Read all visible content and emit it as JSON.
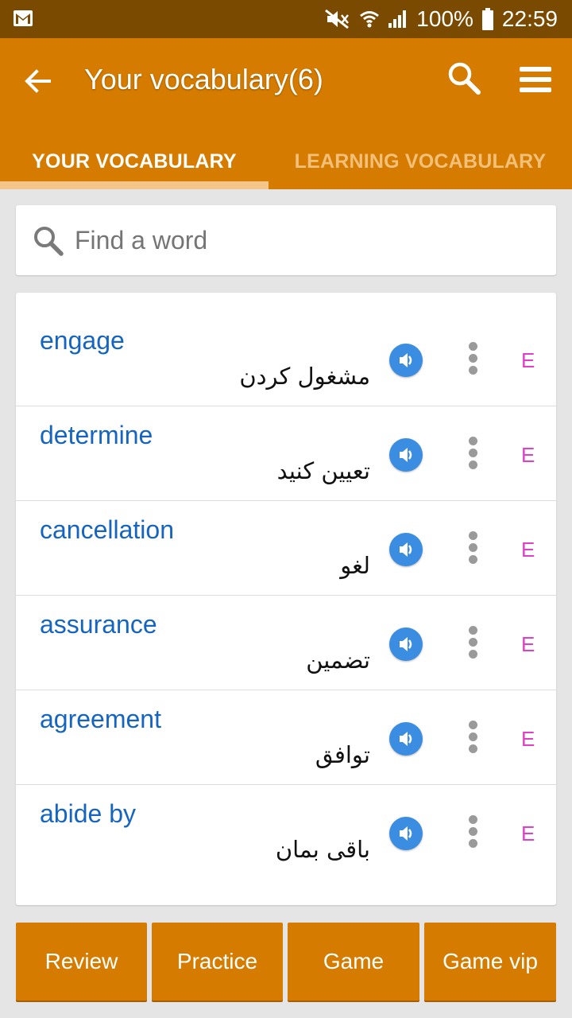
{
  "status_bar": {
    "battery": "100%",
    "time": "22:59",
    "icons": [
      "gmail-icon",
      "mute-icon",
      "wifi-icon",
      "signal-icon",
      "battery-icon"
    ]
  },
  "header": {
    "title": "Your vocabulary(6)",
    "back_icon": "arrow-back-icon",
    "search_icon": "search-icon",
    "menu_icon": "menu-icon"
  },
  "tabs": [
    {
      "label": "YOUR VOCABULARY",
      "active": true
    },
    {
      "label": "LEARNING VOCABULARY",
      "active": false
    }
  ],
  "search": {
    "placeholder": "Find a word",
    "value": ""
  },
  "vocabulary": [
    {
      "word": "engage",
      "translation": "مشغول کردن",
      "badge": "E"
    },
    {
      "word": "determine",
      "translation": "تعیین کنید",
      "badge": "E"
    },
    {
      "word": "cancellation",
      "translation": "لغو",
      "badge": "E"
    },
    {
      "word": "assurance",
      "translation": "تضمین",
      "badge": "E"
    },
    {
      "word": "agreement",
      "translation": "توافق",
      "badge": "E"
    },
    {
      "word": "abide by",
      "translation": "باقی بمان",
      "badge": "E"
    }
  ],
  "buttons": {
    "review": "Review",
    "practice": "Practice",
    "game": "Game",
    "game_vip": "Game vip"
  },
  "colors": {
    "status_bar": "#7a4a00",
    "primary": "#d57c00",
    "tab_inactive": "#f3c07a",
    "tab_indicator": "#f6c58a",
    "word": "#1565c0",
    "speak_button": "#3a8de0",
    "badge": "#e040c8",
    "background": "#e5e5e5"
  }
}
